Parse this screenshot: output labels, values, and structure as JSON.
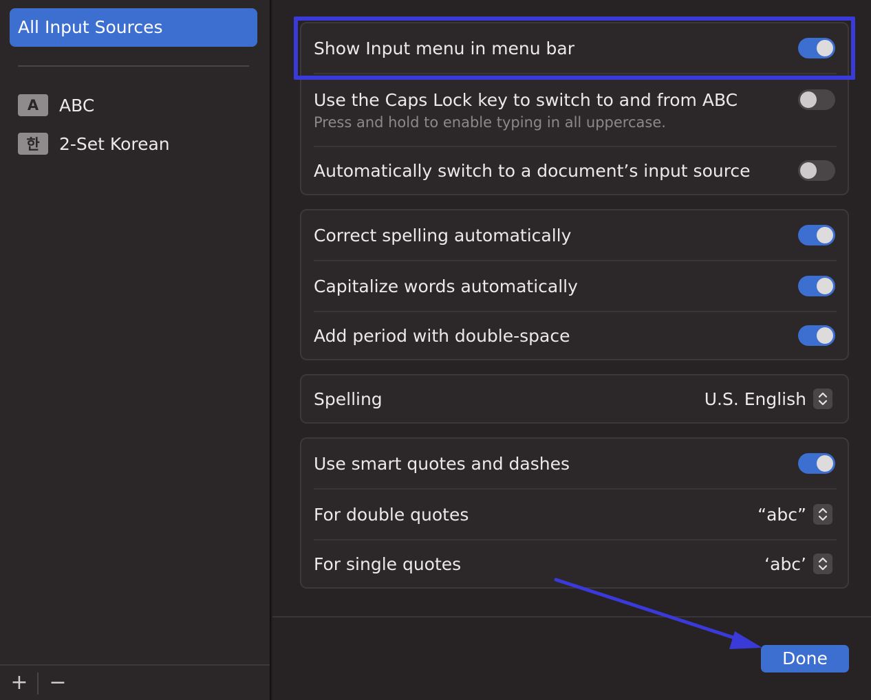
{
  "sidebar": {
    "selected_label": "All Input Sources",
    "sources": [
      {
        "badge": "A",
        "label": "ABC"
      },
      {
        "badge": "한",
        "label": "2-Set Korean"
      }
    ],
    "add_label": "+",
    "remove_label": "−"
  },
  "groups": {
    "input_menu": {
      "show_input_menu": {
        "label": "Show Input menu in menu bar",
        "on": true
      },
      "caps_lock": {
        "label": "Use the Caps Lock key to switch to and from ABC",
        "sub": "Press and hold to enable typing in all uppercase.",
        "on": false
      },
      "auto_switch": {
        "label": "Automatically switch to a document’s input source",
        "on": false
      }
    },
    "text": {
      "correct_spelling": {
        "label": "Correct spelling automatically",
        "on": true
      },
      "capitalize": {
        "label": "Capitalize words automatically",
        "on": true
      },
      "period": {
        "label": "Add period with double-space",
        "on": true
      }
    },
    "spelling": {
      "label": "Spelling",
      "value": "U.S. English"
    },
    "quotes": {
      "smart_quotes": {
        "label": "Use smart quotes and dashes",
        "on": true
      },
      "double": {
        "label": "For double quotes",
        "value": "“abc”"
      },
      "single": {
        "label": "For single quotes",
        "value": "‘abc’"
      }
    }
  },
  "done_label": "Done",
  "colors": {
    "accent": "#3c6fd0",
    "annotation": "#3a3ad8"
  }
}
